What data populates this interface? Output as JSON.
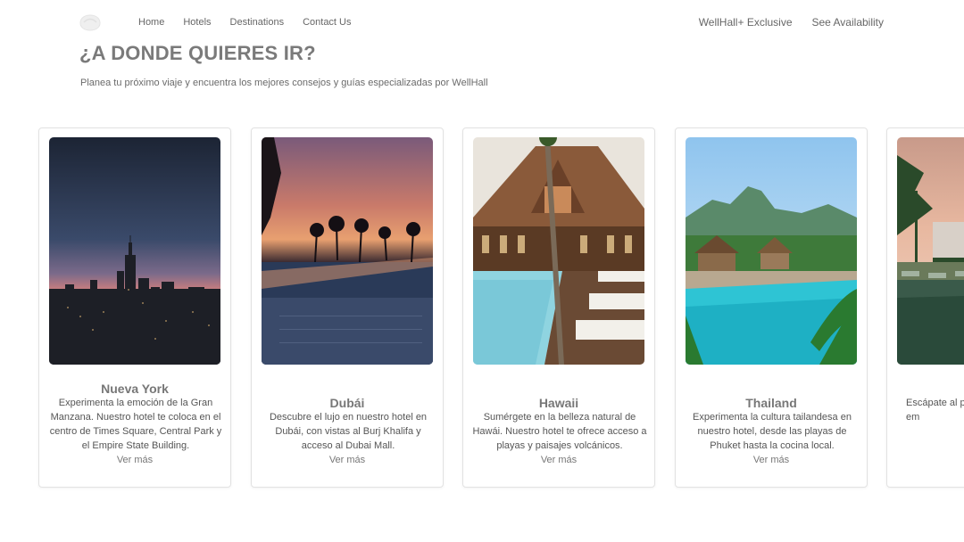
{
  "nav": {
    "left": [
      "Home",
      "Hotels",
      "Destinations",
      "Contact Us"
    ],
    "right": [
      "WellHall+ Exclusive",
      "See Availability"
    ]
  },
  "hero": {
    "title": "¿A DONDE QUIERES IR?",
    "subtitle": "Planea tu próximo viaje y encuentra los mejores consejos y guías especializadas por WellHall"
  },
  "cards": [
    {
      "title": "Nueva York",
      "description": "Experimenta la emoción de la Gran Manzana. Nuestro hotel te coloca en el centro de Times Square, Central Park y el Empire State Building.",
      "more": "Ver más",
      "image": "new-york-skyline-dusk"
    },
    {
      "title": "Dubái",
      "description": "Descubre el lujo en nuestro hotel en Dubái, con vistas al Burj Khalifa y acceso al Dubai Mall.",
      "more": "Ver más",
      "image": "dubai-pool-sunset"
    },
    {
      "title": "Hawaii",
      "description": "Sumérgete en la belleza natural de Hawái. Nuestro hotel te ofrece acceso a playas y paisajes volcánicos.",
      "more": "Ver más",
      "image": "hawaii-resort-pool"
    },
    {
      "title": "Thailand",
      "description": "Experimenta la cultura tailandesa en nuestro hotel, desde las playas de Phuket hasta la cocina local.",
      "more": "Ver más",
      "image": "thailand-resort-pool"
    },
    {
      "title": "",
      "description": "Escápate al p Nuestro hotel t exubera em",
      "more": "",
      "image": "tropical-resort-partial"
    }
  ]
}
